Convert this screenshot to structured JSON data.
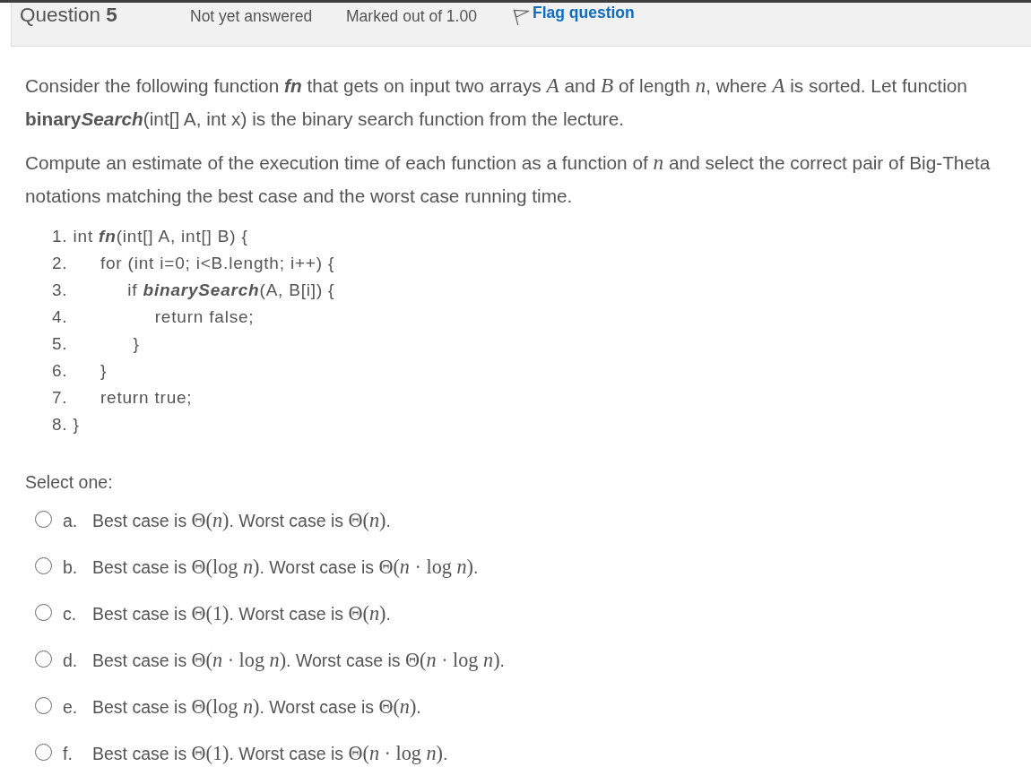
{
  "question": {
    "title": "Question",
    "number": "5",
    "status": "Not yet answered",
    "marks": "Marked out of 1.00",
    "flag": {
      "label": "Flag question",
      "flagged": false
    }
  },
  "paragraphs": [
    [
      {
        "kind": "plain",
        "text": "Consider the following function "
      },
      {
        "kind": "bold-italic",
        "text": "fn"
      },
      {
        "kind": "plain",
        "text": " that gets on input two arrays "
      },
      {
        "kind": "math",
        "text": "*A*"
      },
      {
        "kind": "plain",
        "text": " and "
      },
      {
        "kind": "math",
        "text": "*B*"
      },
      {
        "kind": "plain",
        "text": " of length "
      },
      {
        "kind": "math",
        "text": "*n*"
      },
      {
        "kind": "plain",
        "text": ", where "
      },
      {
        "kind": "math",
        "text": "*A*"
      },
      {
        "kind": "plain",
        "text": " is sorted. Let function "
      },
      {
        "kind": "bold",
        "text": "binary"
      },
      {
        "kind": "bold-italic",
        "text": "Search"
      },
      {
        "kind": "plain",
        "text": "(int[] A, int x) is the binary search function from the lecture."
      }
    ],
    [
      {
        "kind": "plain",
        "text": "Compute an estimate of the execution time of each function as a function of "
      },
      {
        "kind": "math",
        "text": "*n*"
      },
      {
        "kind": "plain",
        "text": " and select the correct pair of Big-Theta notations matching the best case and the worst case running time."
      }
    ]
  ],
  "code": [
    [
      {
        "kind": "plain",
        "text": "1. int "
      },
      {
        "kind": "bold-italic",
        "text": "fn"
      },
      {
        "kind": "plain",
        "text": "(int[] A, int[] B) {"
      }
    ],
    [
      {
        "kind": "plain",
        "text": "2.      for (int i=0; i<B.length; i++) {"
      }
    ],
    [
      {
        "kind": "plain",
        "text": "3.           if "
      },
      {
        "kind": "bold-italic",
        "text": "binarySearch"
      },
      {
        "kind": "plain",
        "text": "(A, B[i]) {"
      }
    ],
    [
      {
        "kind": "plain",
        "text": "4.                return false;"
      }
    ],
    [
      {
        "kind": "plain",
        "text": "5.            }"
      }
    ],
    [
      {
        "kind": "plain",
        "text": "6.      }"
      }
    ],
    [
      {
        "kind": "plain",
        "text": "7.      return true;"
      }
    ],
    [
      {
        "kind": "plain",
        "text": "8. }"
      }
    ]
  ],
  "prompt": "Select one:",
  "options": [
    {
      "letter": "a.",
      "selected": false,
      "runs": [
        {
          "kind": "plain",
          "text": "Best case is "
        },
        {
          "kind": "math",
          "text": "Θ(*n*)"
        },
        {
          "kind": "plain",
          "text": ". Worst case is "
        },
        {
          "kind": "math",
          "text": "Θ(*n*)"
        },
        {
          "kind": "plain",
          "text": "."
        }
      ]
    },
    {
      "letter": "b.",
      "selected": false,
      "runs": [
        {
          "kind": "plain",
          "text": "Best case is "
        },
        {
          "kind": "math",
          "text": "Θ(log *n*)"
        },
        {
          "kind": "plain",
          "text": ". Worst case is "
        },
        {
          "kind": "math",
          "text": "Θ(*n* · log *n*)"
        },
        {
          "kind": "plain",
          "text": "."
        }
      ]
    },
    {
      "letter": "c.",
      "selected": false,
      "runs": [
        {
          "kind": "plain",
          "text": "Best case is "
        },
        {
          "kind": "math",
          "text": "Θ(1)"
        },
        {
          "kind": "plain",
          "text": ". Worst case is "
        },
        {
          "kind": "math",
          "text": "Θ(*n*)"
        },
        {
          "kind": "plain",
          "text": "."
        }
      ]
    },
    {
      "letter": "d.",
      "selected": false,
      "runs": [
        {
          "kind": "plain",
          "text": "Best case is "
        },
        {
          "kind": "math",
          "text": "Θ(*n* · log *n*)"
        },
        {
          "kind": "plain",
          "text": ". Worst case is "
        },
        {
          "kind": "math",
          "text": "Θ(*n* · log *n*)"
        },
        {
          "kind": "plain",
          "text": "."
        }
      ]
    },
    {
      "letter": "e.",
      "selected": false,
      "runs": [
        {
          "kind": "plain",
          "text": "Best case is "
        },
        {
          "kind": "math",
          "text": "Θ(log *n*)"
        },
        {
          "kind": "plain",
          "text": ". Worst case is "
        },
        {
          "kind": "math",
          "text": "Θ(*n*)"
        },
        {
          "kind": "plain",
          "text": "."
        }
      ]
    },
    {
      "letter": "f.",
      "selected": false,
      "runs": [
        {
          "kind": "plain",
          "text": "Best case is "
        },
        {
          "kind": "math",
          "text": "Θ(1)"
        },
        {
          "kind": "plain",
          "text": ". Worst case is "
        },
        {
          "kind": "math",
          "text": "Θ(*n* · log *n*)"
        },
        {
          "kind": "plain",
          "text": "."
        }
      ]
    }
  ]
}
